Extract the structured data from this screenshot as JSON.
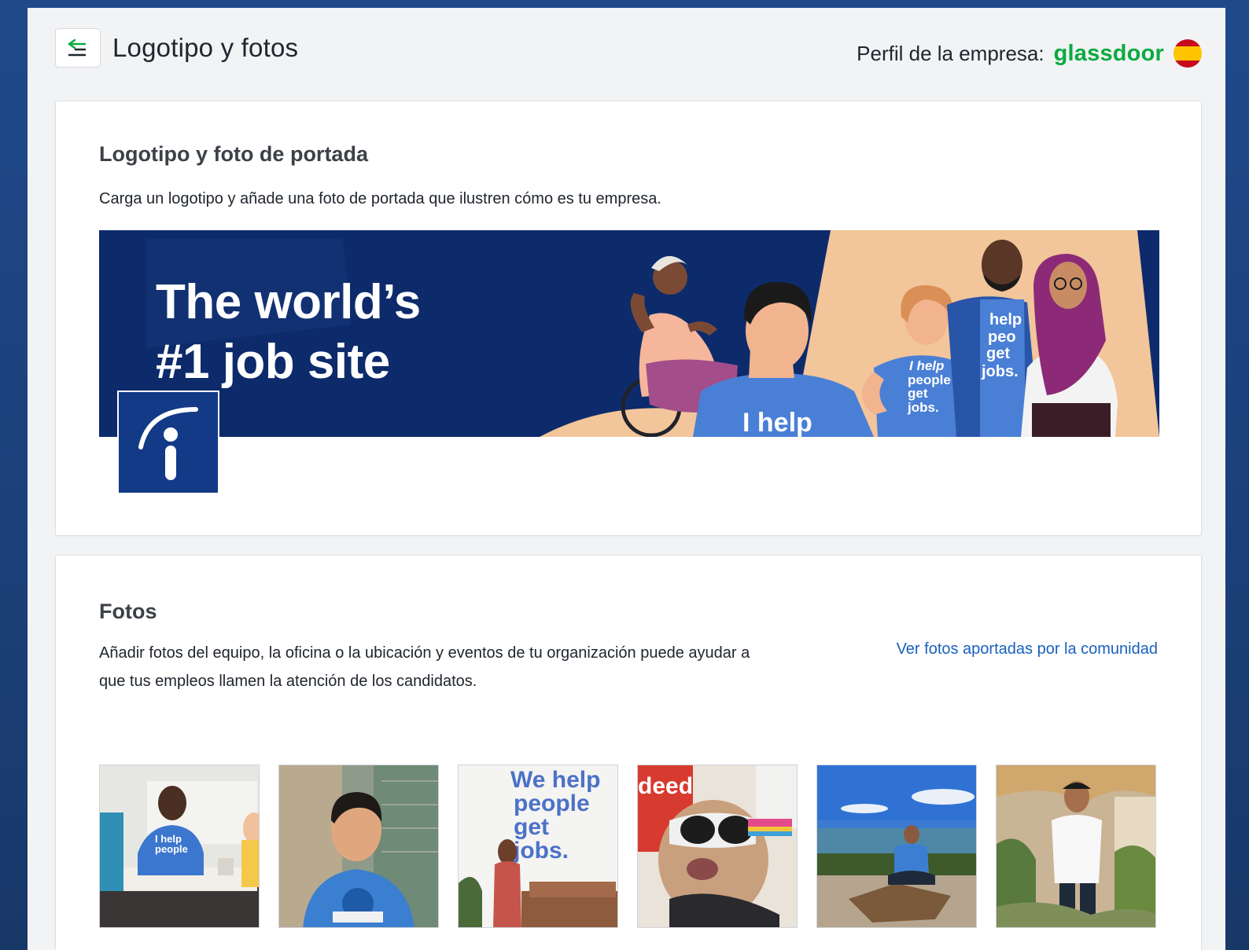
{
  "header": {
    "title": "Logotipo y fotos",
    "company_label": "Perfil de la empresa:",
    "brand_name": "glassdoor",
    "flag_icon": "spain-flag-icon"
  },
  "logo_section": {
    "title": "Logotipo y foto de portada",
    "description": "Carga un logotipo y añade una foto de portada que ilustren cómo es tu empresa.",
    "cover": {
      "headline_line1": "The world’s",
      "headline_line2": "#1 job site",
      "shirt_text_large": "I help",
      "shirt_text_small": [
        "I help",
        "people",
        "get",
        "jobs."
      ],
      "shirt_text_side": [
        "help",
        "peo",
        "get",
        "jobs."
      ]
    },
    "logo_icon": "indeed-logo-icon"
  },
  "photos_section": {
    "title": "Fotos",
    "description_line1": "Añadir fotos del equipo, la oficina o la ubicación y eventos de tu organización puede ayudar a",
    "description_line2": "que tus empleos llamen la atención de los candidatos.",
    "community_link": "Ver fotos aportadas por la comunidad",
    "photos": [
      {
        "name": "team-meeting-photo",
        "caption": "I help people"
      },
      {
        "name": "employee-portrait-photo",
        "caption": ""
      },
      {
        "name": "office-wall-photo",
        "caption": "We help people get jobs."
      },
      {
        "name": "dog-sunglasses-photo",
        "caption": "deed"
      },
      {
        "name": "outdoor-meditation-photo",
        "caption": ""
      },
      {
        "name": "garden-portrait-photo",
        "caption": ""
      }
    ]
  },
  "colors": {
    "brand_green": "#0caa41",
    "link_blue": "#1861bf",
    "cover_navy": "#0d2b6b",
    "page_bg": "#f2f3f5"
  }
}
